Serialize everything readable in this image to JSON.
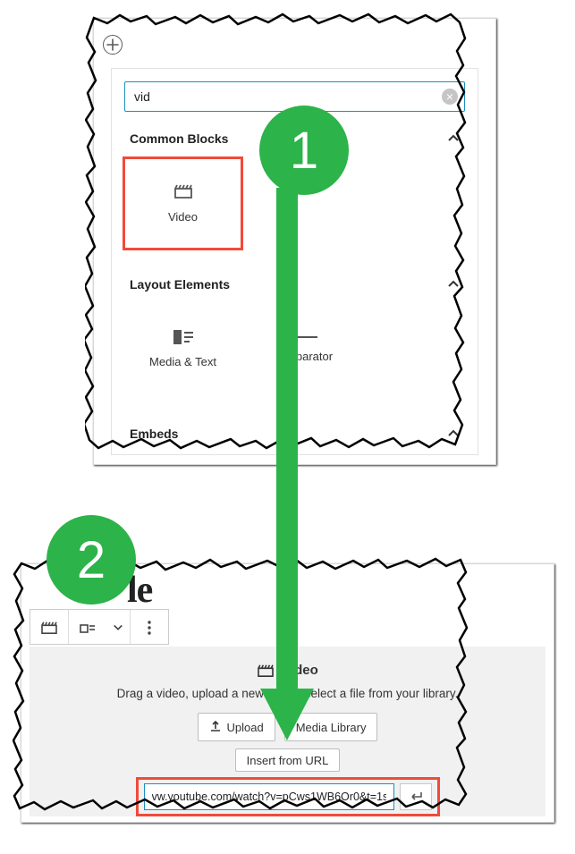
{
  "steps": {
    "one": "1",
    "two": "2"
  },
  "inserter": {
    "search_value": "vid",
    "sections": {
      "common": {
        "label": "Common Blocks",
        "items": [
          {
            "label": "Video"
          }
        ]
      },
      "layout": {
        "label": "Layout Elements",
        "items": [
          {
            "label": "Media & Text"
          },
          {
            "label": "Separator"
          }
        ]
      },
      "embeds": {
        "label": "Embeds"
      }
    }
  },
  "video_block": {
    "title_fragment": "le",
    "heading": "Video",
    "subtitle": "Drag a video, upload a new one or select a file from your library.",
    "upload_button": "Upload",
    "media_library_button": "Media Library",
    "insert_url_link": "Insert from URL",
    "url_value": "vw.youtube.com/watch?v=pCws1WB6Or0&t=1s"
  }
}
